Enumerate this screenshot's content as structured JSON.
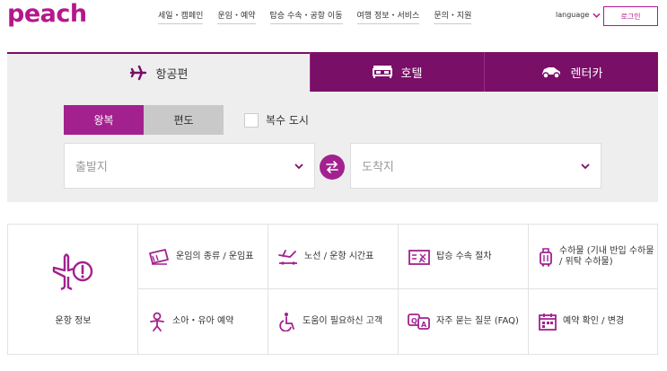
{
  "brand": {
    "logo": "peach",
    "color": "#b5178b",
    "dark": "#7a0f67"
  },
  "header": {
    "nav": [
      "세일・캠페인",
      "운임・예약",
      "탑승 수속・공항 이동",
      "여행 정보・서비스",
      "문의・지원"
    ],
    "language": "language",
    "login": "로그인"
  },
  "booking": {
    "tabs": [
      {
        "label": "항공편",
        "icon": "airplane-icon",
        "active": true
      },
      {
        "label": "호텔",
        "icon": "bed-icon",
        "active": false
      },
      {
        "label": "렌터카",
        "icon": "car-icon",
        "active": false
      }
    ],
    "trip": {
      "roundtrip": "왕복",
      "oneway": "편도",
      "selected": "왕복"
    },
    "multi_city": "복수 도시",
    "origin_placeholder": "출발지",
    "destination_placeholder": "도착지"
  },
  "info": {
    "flight_status": "운항 정보",
    "items": [
      {
        "label": "운임의 종류 / 운임표",
        "icon": "ticket-icon"
      },
      {
        "label": "노선 / 운항 시간표",
        "icon": "route-icon"
      },
      {
        "label": "탑승 수속 절차",
        "icon": "boarding-pass-icon"
      },
      {
        "label": "수하물 (기내 반입 수하물 / 위탁 수하물)",
        "icon": "luggage-icon"
      },
      {
        "label": "소아・유아 예약",
        "icon": "child-icon"
      },
      {
        "label": "도움이 필요하신 고객",
        "icon": "wheelchair-icon"
      },
      {
        "label": "자주 묻는 질문 (FAQ)",
        "icon": "qa-icon"
      },
      {
        "label": "예약 확인 / 변경",
        "icon": "calendar-icon"
      }
    ]
  }
}
